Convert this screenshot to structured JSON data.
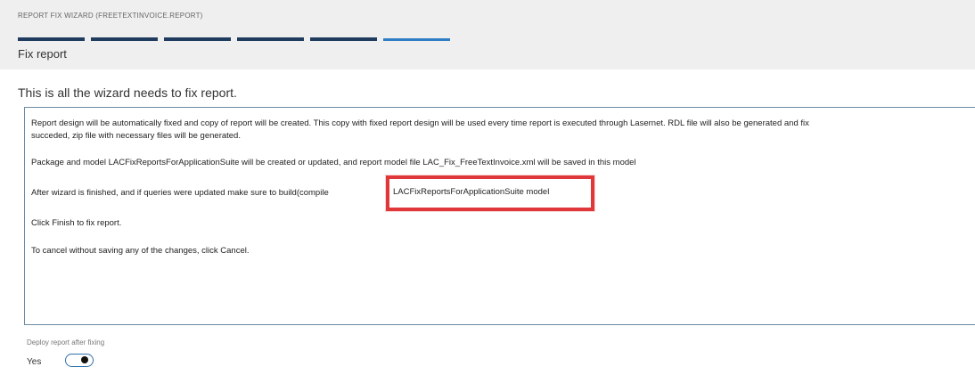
{
  "wizard": {
    "title": "REPORT FIX WIZARD (FREETEXTINVOICE.REPORT)",
    "step_title": "Fix report",
    "heading": "This is all the wizard needs to fix report."
  },
  "message": {
    "line1": "Report design will be automatically fixed and copy of report will be created. This copy with fixed report design will be used every time report is executed through Lasernet. RDL file will also be generated and fix",
    "line2": "succeded, zip file with necessary files will be generated.",
    "line3": "Package and model LACFixReportsForApplicationSuite will be created or updated, and report model file LAC_Fix_FreeTextInvoice.xml will be saved in this model",
    "line4": "After wizard is finished, and if queries were updated make sure to build(compile",
    "line4_highlight": "LACFixReportsForApplicationSuite model",
    "line5": "Click Finish to fix report.",
    "line6": "To cancel without saving any of the changes, click Cancel."
  },
  "deploy": {
    "label": "Deploy report after fixing",
    "state": "Yes",
    "value": true
  },
  "colors": {
    "step_complete": "#1f3b5e",
    "step_current": "#2f7dc4",
    "highlight_border": "#e0373b"
  }
}
